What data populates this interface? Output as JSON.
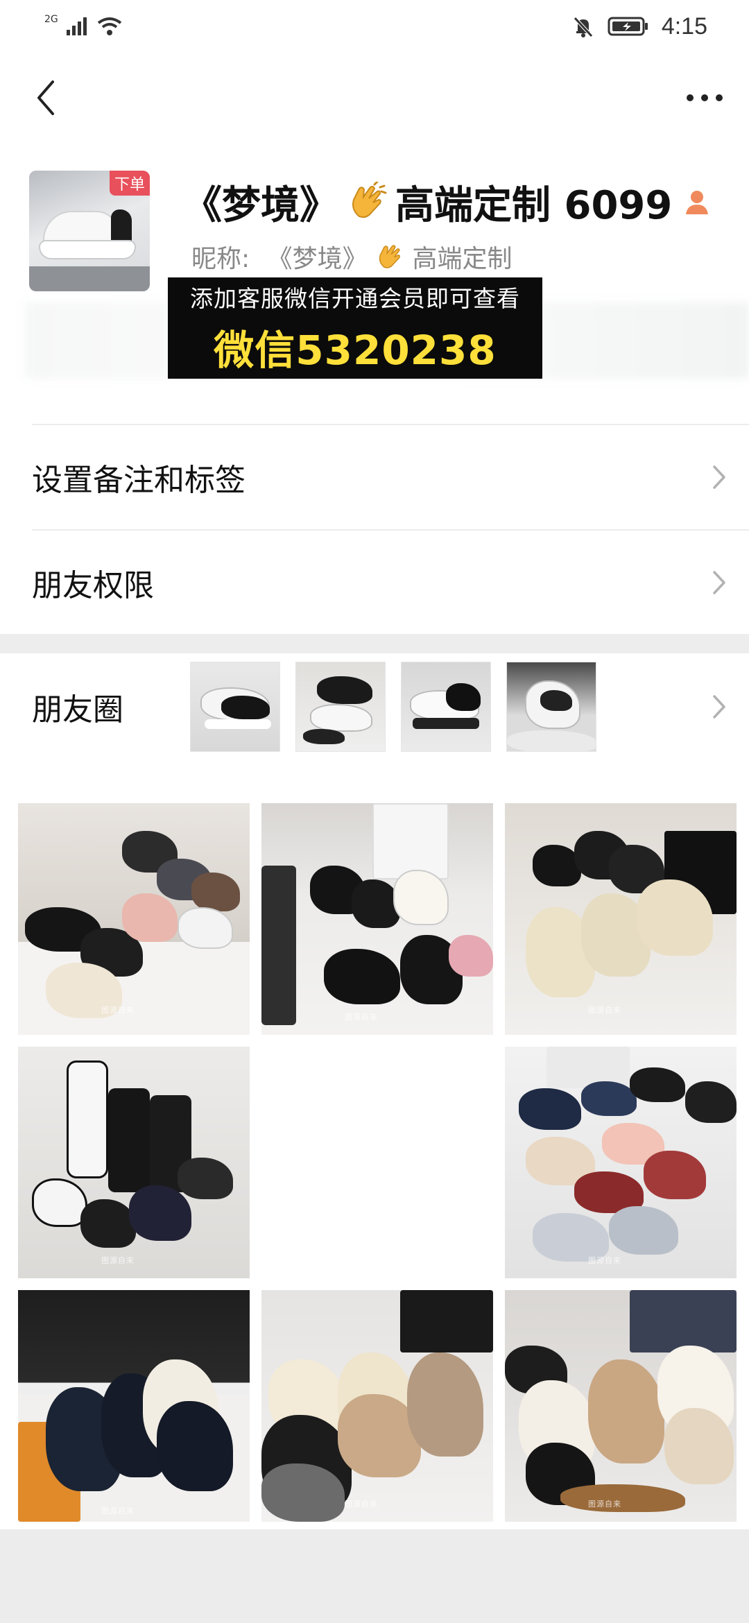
{
  "status_bar": {
    "network": "2G",
    "time": "4:15"
  },
  "icons": {
    "back": "chevron-left-icon",
    "more": "more-dots-icon",
    "gender": "female-icon",
    "clap": "clapping-hands-emoji",
    "chevron": "chevron-right-icon"
  },
  "profile": {
    "badge": "下单",
    "title_prefix": "《梦境》",
    "title_suffix": "高端定制 6099",
    "nickname_label": "昵称:",
    "nickname_prefix": "《梦境》",
    "nickname_suffix": "高端定制",
    "promo_line1": "添加客服微信开通会员即可查看",
    "promo_line2": "微信5320238"
  },
  "menu": {
    "remark_tags": "设置备注和标签",
    "friend_permissions": "朋友权限",
    "moments": "朋友圈"
  },
  "moments_thumbs": [
    {
      "label": "moment-thumb-1"
    },
    {
      "label": "moment-thumb-2"
    },
    {
      "label": "moment-thumb-3"
    },
    {
      "label": "moment-thumb-4"
    }
  ],
  "grid_photos": [
    {
      "id": 1,
      "empty": false
    },
    {
      "id": 2,
      "empty": false
    },
    {
      "id": 3,
      "empty": false
    },
    {
      "id": 4,
      "empty": false
    },
    {
      "id": 5,
      "empty": true
    },
    {
      "id": 6,
      "empty": false
    },
    {
      "id": 7,
      "empty": false
    },
    {
      "id": 8,
      "empty": false
    },
    {
      "id": 9,
      "empty": false
    }
  ],
  "colors": {
    "badge_red": "#e8505b",
    "promo_bg": "#0b0b0b",
    "promo_yellow": "#ffe03a",
    "gender_orange": "#f08a5d",
    "divider": "#ececec"
  }
}
